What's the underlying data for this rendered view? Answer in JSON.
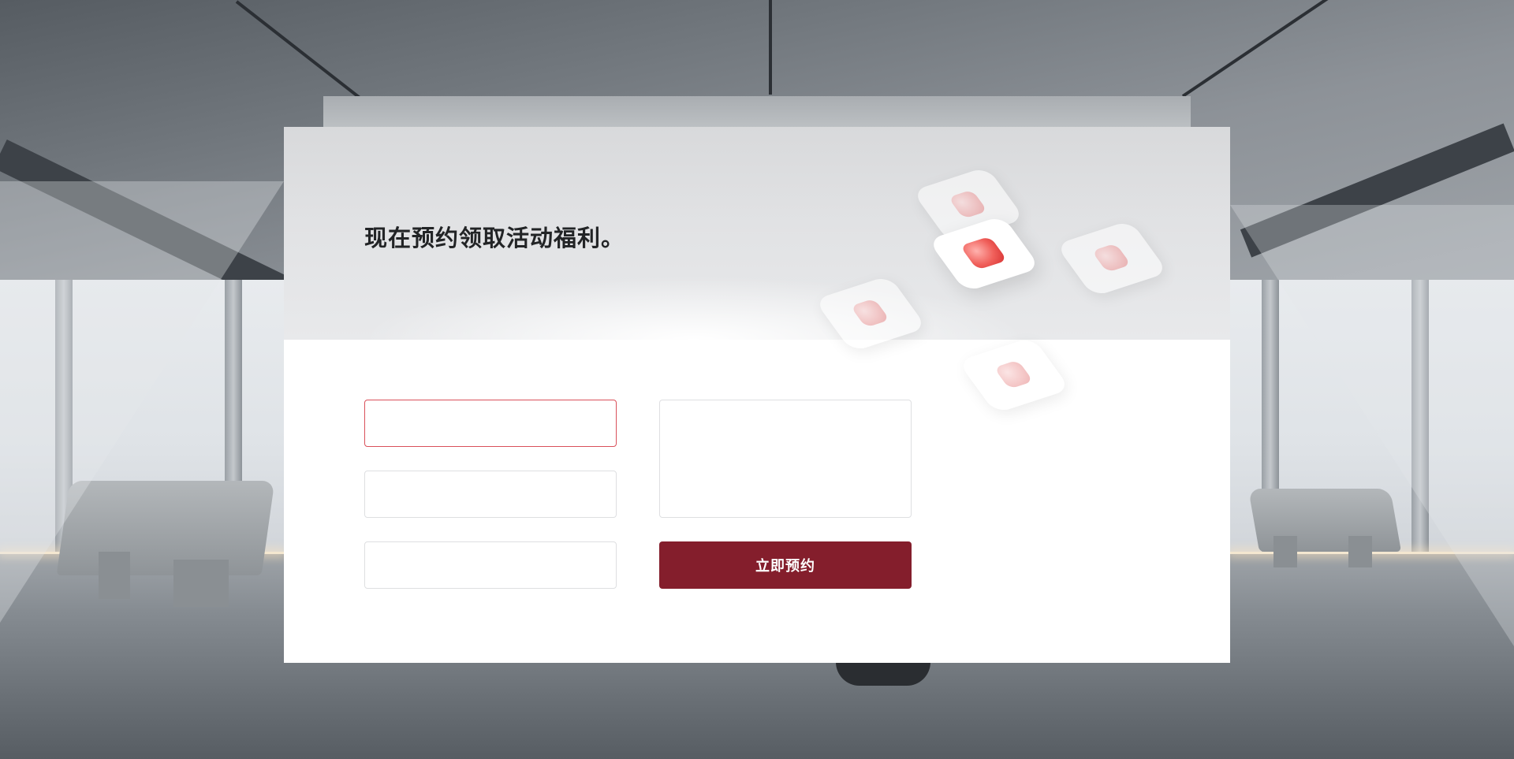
{
  "hero": {
    "title": "现在预约领取活动福利。"
  },
  "form": {
    "name": {
      "value": "",
      "placeholder": ""
    },
    "phone": {
      "value": "",
      "placeholder": ""
    },
    "company": {
      "value": "",
      "placeholder": ""
    },
    "message": {
      "value": "",
      "placeholder": ""
    },
    "submit_label": "立即预约"
  },
  "colors": {
    "accent": "#841e2c",
    "active_border": "#d9505a",
    "tile_glyph": "#e05a5a"
  },
  "icons": [
    "app-tile-icon"
  ]
}
